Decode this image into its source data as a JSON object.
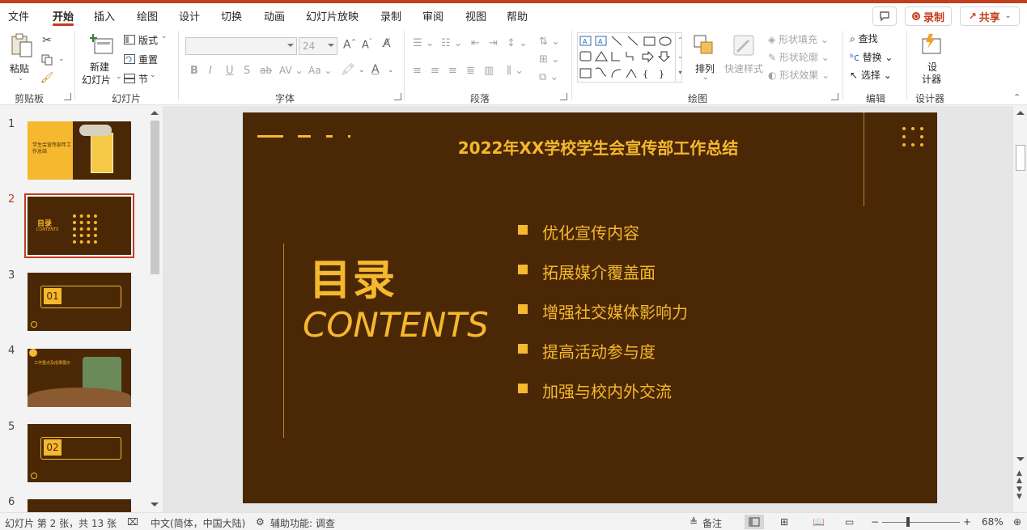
{
  "menu": {
    "tabs": [
      "文件",
      "开始",
      "插入",
      "绘图",
      "设计",
      "切换",
      "动画",
      "幻灯片放映",
      "录制",
      "审阅",
      "视图",
      "帮助"
    ],
    "active_tab": "开始",
    "record_label": "录制",
    "share_label": "共享"
  },
  "ribbon": {
    "clipboard": {
      "paste": "粘贴",
      "group": "剪贴板"
    },
    "slides": {
      "new_slide_1": "新建",
      "new_slide_2": "幻灯片",
      "layout": "版式",
      "reset": "重置",
      "section": "节",
      "group": "幻灯片"
    },
    "font": {
      "size": "24",
      "group": "字体"
    },
    "paragraph": {
      "group": "段落"
    },
    "drawing": {
      "arrange": "排列",
      "quick_styles": "快速样式",
      "shape_fill": "形状填充",
      "shape_outline": "形状轮廓",
      "shape_effects": "形状效果",
      "group": "绘图"
    },
    "editing": {
      "find": "查找",
      "replace": "替换",
      "select": "选择",
      "group": "编辑"
    },
    "designer": {
      "label_1": "设",
      "label_2": "计器",
      "group": "设计器"
    }
  },
  "thumbnails": {
    "numbers": [
      "1",
      "2",
      "3",
      "4",
      "5",
      "6"
    ],
    "selected": "2",
    "t1_title": "学生会宣传部年工作总结",
    "t2_title": "目录",
    "t2_sub": "CONTENTS",
    "t3_num": "01",
    "t5_num": "02",
    "t4_title": "工作重点及成果展示"
  },
  "slide": {
    "title": "2022年XX学校学生会宣传部工作总结",
    "heading": "目录",
    "subheading": "CONTENTS",
    "items": [
      "优化宣传内容",
      "拓展媒介覆盖面",
      "增强社交媒体影响力",
      "提高活动参与度",
      "加强与校内外交流"
    ]
  },
  "status": {
    "slide_info": "幻灯片 第 2 张，共 13 张",
    "language": "中文(简体，中国大陆)",
    "accessibility": "辅助功能: 调查",
    "notes": "备注",
    "zoom": "68%"
  },
  "colors": {
    "accent": "#c43e1c",
    "slide_bg": "#4a2806",
    "slide_gold": "#f5b82e"
  }
}
